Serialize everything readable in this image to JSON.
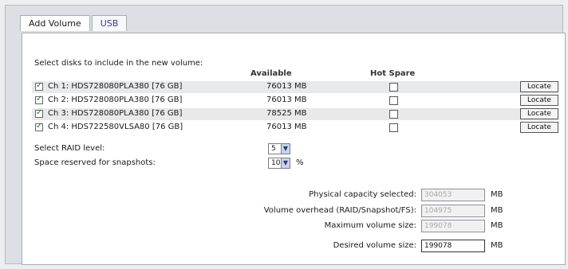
{
  "tabs": [
    {
      "label": "Add Volume"
    },
    {
      "label": "USB"
    }
  ],
  "disks_section": {
    "intro": "Select disks to include in the new volume:",
    "col_available": "Available",
    "col_hot_spare": "Hot Spare",
    "disks": [
      {
        "label": "Ch 1: HDS728080PLA380 [76 GB]",
        "available": "76013 MB",
        "checked": true,
        "hot_spare": false,
        "locate_label": "Locate"
      },
      {
        "label": "Ch 2: HDS728080PLA380 [76 GB]",
        "available": "76013 MB",
        "checked": true,
        "hot_spare": false,
        "locate_label": "Locate"
      },
      {
        "label": "Ch 3: HDS728080PLA380 [76 GB]",
        "available": "78525 MB",
        "checked": true,
        "hot_spare": false,
        "locate_label": "Locate"
      },
      {
        "label": "Ch 4: HDS722580VLSA80 [76 GB]",
        "available": "76013 MB",
        "checked": true,
        "hot_spare": false,
        "locate_label": "Locate"
      }
    ]
  },
  "raid": {
    "label": "Select RAID level:",
    "value": "5"
  },
  "snapshot": {
    "label": "Space reserved for snapshots:",
    "value": "10",
    "unit": "%"
  },
  "capacity": {
    "physical_label": "Physical capacity selected:",
    "physical_value": "304053",
    "overhead_label": "Volume overhead (RAID/Snapshot/FS):",
    "overhead_value": "104975",
    "max_label": "Maximum volume size:",
    "max_value": "199078",
    "desired_label": "Desired volume size:",
    "desired_value": "199078",
    "unit": "MB"
  },
  "icons": {
    "checkbox_checked": "checkmark-icon",
    "dropdown": "chevron-down-icon"
  }
}
